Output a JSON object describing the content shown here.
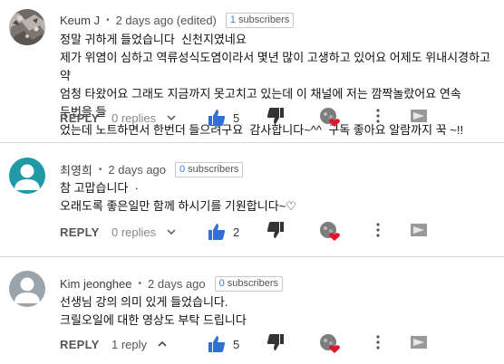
{
  "ui": {
    "reply_label": "REPLY",
    "dot": "•",
    "subscribers_suffix": "subscribers"
  },
  "comments": [
    {
      "author": "Keum J",
      "time": "2 days ago (edited)",
      "subscriber_count": "1",
      "body_lines": [
        "정말 귀하게 들었습니다  신천지였네요",
        "제가 위염이 심하고 역류성식도염이라서 몇년 많이 고생하고 있어요 어제도 위내시경하고 약",
        "엄청 타왔어요 그래도 지금까지 못고치고 있는데 이 채널에 저는 깜짝놀랐어요 연속 두번을 들",
        "었는데 노트하면서 한번더 들으려구요  감사합니다~^^  구독 좋아요 알람까지 꾹 ~!!"
      ],
      "replies_text": "0 replies",
      "likes": "5",
      "avatar_color": "#8a8a8a"
    },
    {
      "author": "최영희",
      "time": "2 days ago",
      "subscriber_count": "0",
      "body_lines": [
        "참 고맙습니다  ·",
        "오래도록 좋은일만 함께 하시기를 기원합니다~♡"
      ],
      "replies_text": "0 replies",
      "likes": "2",
      "avatar_color": "#1f9aa6"
    },
    {
      "author": "Kim jeonghee",
      "time": "2 days ago",
      "subscriber_count": "0",
      "body_lines": [
        "선생님 강의 의미 있게 들었습니다.",
        "크릴오일에 대한 영상도 부탁 드립니다"
      ],
      "replies_text": "1 reply",
      "likes": "5",
      "avatar_color": "#9aa4ad"
    }
  ]
}
